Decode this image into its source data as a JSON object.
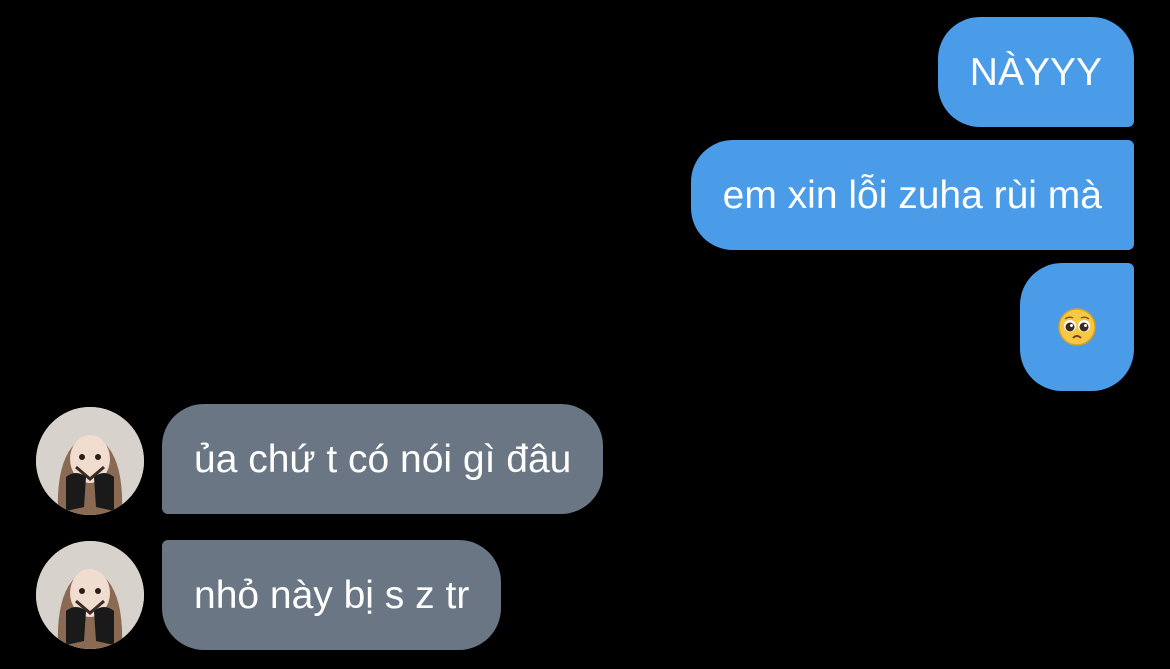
{
  "conversation": {
    "sent_messages": [
      {
        "text": "NÀYYY"
      },
      {
        "text": "em xin lỗi zuha rùi mà"
      },
      {
        "text": "🥺",
        "emoji_name": "pleading-face"
      }
    ],
    "received_messages": [
      {
        "text": "ủa chứ t có nói gì đâu"
      },
      {
        "text": "nhỏ này bị s z tr"
      }
    ]
  },
  "colors": {
    "background": "#000000",
    "sent_bubble": "#4a9be8",
    "received_bubble": "#6b7684",
    "text": "#ffffff"
  }
}
